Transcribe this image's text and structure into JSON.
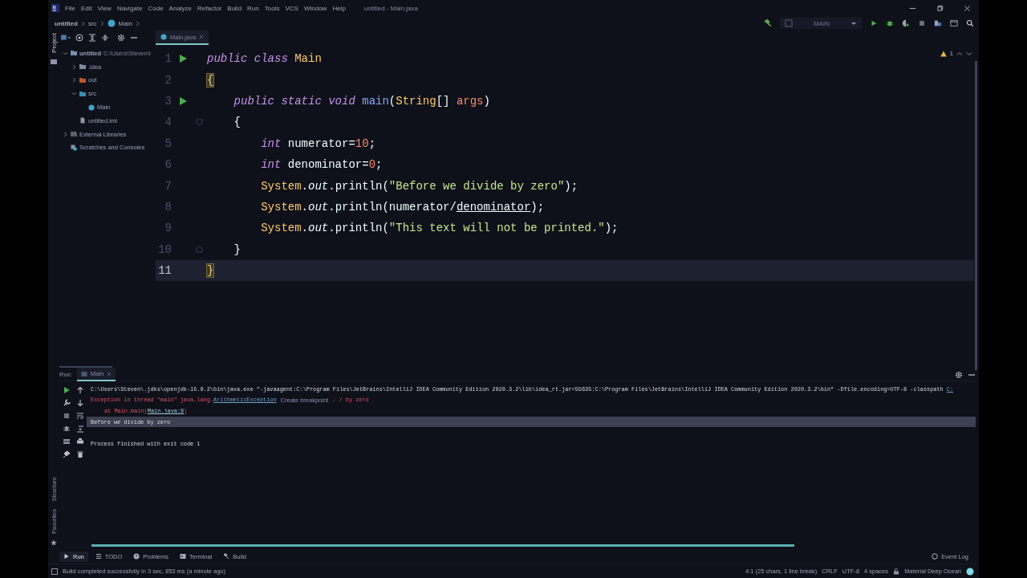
{
  "menu_bar": {
    "items": [
      "File",
      "Edit",
      "View",
      "Navigate",
      "Code",
      "Analyze",
      "Refactor",
      "Build",
      "Run",
      "Tools",
      "VCS",
      "Window",
      "Help"
    ],
    "title": "untitled - Main.java"
  },
  "breadcrumbs": [
    "untitled",
    "src",
    "Main"
  ],
  "toolbar": {
    "run_config": "MAIN"
  },
  "side_stripe": {
    "top": "Project",
    "bottom": [
      "Structure",
      "Favorites"
    ]
  },
  "project_tree": [
    {
      "label": "untitled",
      "path": "C:\\Users\\Steven\\I",
      "kind": "module",
      "expanded": true,
      "children": [
        {
          "label": ".idea",
          "kind": "folder",
          "expanded": false
        },
        {
          "label": "out",
          "kind": "excluded",
          "expanded": false
        },
        {
          "label": "src",
          "kind": "source",
          "expanded": true,
          "children": [
            {
              "label": "Main",
              "kind": "class"
            }
          ]
        },
        {
          "label": "untitled.iml",
          "kind": "file"
        }
      ]
    },
    {
      "label": "External Libraries",
      "kind": "library",
      "expanded": false
    },
    {
      "label": "Scratches and Consoles",
      "kind": "scratch"
    }
  ],
  "editor_tabs": [
    {
      "label": "Main.java",
      "selected": true
    }
  ],
  "inspection": {
    "warnings": "1"
  },
  "code": [
    {
      "number": "1",
      "current": false,
      "run_marker": true,
      "fold_marker": false,
      "tokens": [
        {
          "text": "public class ",
          "kind": "keyword"
        },
        {
          "text": "Main",
          "kind": "class"
        }
      ]
    },
    {
      "number": "2",
      "current": false,
      "run_marker": false,
      "fold_marker": false,
      "tokens": [
        {
          "text": "{",
          "kind": "brace-match"
        }
      ],
      "children": [
        {
          "number": "3",
          "current": false,
          "run_marker": true,
          "fold_marker": false,
          "tokens": [
            {
              "text": "public static void ",
              "kind": "keyword"
            },
            {
              "text": "main",
              "kind": "method"
            },
            {
              "text": "(",
              "kind": "plain"
            },
            {
              "text": "String",
              "kind": "class"
            },
            {
              "text": "[] ",
              "kind": "plain"
            },
            {
              "text": "args",
              "kind": "param"
            },
            {
              "text": ")",
              "kind": "plain"
            }
          ]
        },
        {
          "number": "4",
          "current": false,
          "run_marker": false,
          "fold_marker": true,
          "tokens": [
            {
              "text": "{",
              "kind": "plain"
            }
          ],
          "children": [
            {
              "number": "5",
              "current": false,
              "run_marker": false,
              "fold_marker": false,
              "tokens": [
                {
                  "text": "int ",
                  "kind": "keyword"
                },
                {
                  "text": "numerator=",
                  "kind": "plain"
                },
                {
                  "text": "10",
                  "kind": "number"
                },
                {
                  "text": ";",
                  "kind": "plain"
                }
              ]
            },
            {
              "number": "6",
              "current": false,
              "run_marker": false,
              "fold_marker": false,
              "tokens": [
                {
                  "text": "int ",
                  "kind": "keyword"
                },
                {
                  "text": "denominator=",
                  "kind": "plain"
                },
                {
                  "text": "0",
                  "kind": "number"
                },
                {
                  "text": ";",
                  "kind": "plain"
                }
              ]
            },
            {
              "number": "7",
              "current": false,
              "run_marker": false,
              "fold_marker": false,
              "tokens": [
                {
                  "text": "System",
                  "kind": "class"
                },
                {
                  "text": ".",
                  "kind": "plain"
                },
                {
                  "text": "out",
                  "kind": "field"
                },
                {
                  "text": ".println(",
                  "kind": "plain"
                },
                {
                  "text": "\"Before we divide by zero\"",
                  "kind": "string"
                },
                {
                  "text": ");",
                  "kind": "plain"
                }
              ]
            },
            {
              "number": "8",
              "current": false,
              "run_marker": false,
              "fold_marker": false,
              "tokens": [
                {
                  "text": "System",
                  "kind": "class"
                },
                {
                  "text": ".",
                  "kind": "plain"
                },
                {
                  "text": "out",
                  "kind": "field"
                },
                {
                  "text": ".println(numerator/",
                  "kind": "plain"
                },
                {
                  "text": "denominator",
                  "kind": "underlined"
                },
                {
                  "text": ");",
                  "kind": "plain"
                }
              ]
            },
            {
              "number": "9",
              "current": false,
              "run_marker": false,
              "fold_marker": false,
              "tokens": [
                {
                  "text": "System",
                  "kind": "class"
                },
                {
                  "text": ".",
                  "kind": "plain"
                },
                {
                  "text": "out",
                  "kind": "field"
                },
                {
                  "text": ".println(",
                  "kind": "plain"
                },
                {
                  "text": "\"This text will not be printed.\"",
                  "kind": "string"
                },
                {
                  "text": ");",
                  "kind": "plain"
                }
              ]
            }
          ]
        },
        {
          "number": "10",
          "current": false,
          "run_marker": false,
          "fold_marker": true,
          "tokens": [
            {
              "text": "}",
              "kind": "plain"
            }
          ]
        }
      ]
    },
    {
      "number": "11",
      "current": true,
      "run_marker": false,
      "fold_marker": false,
      "tokens": [
        {
          "text": "}",
          "kind": "brace-match"
        }
      ]
    }
  ],
  "run_panel": {
    "label": "Run:",
    "tabs": [
      {
        "label": "Main",
        "selected": true
      }
    ],
    "console": [
      {
        "kind": "command",
        "selected": false,
        "segments": [
          {
            "text": "C:\\Users\\Steven\\.jdks\\openjdk-15.0.2\\bin\\java.exe \"-javaagent:C:\\Program Files\\JetBrains\\IntelliJ IDEA Community Edition 2020.3.2\\lib\\idea_rt.jar=55635:C:\\Program Files\\JetBrains\\IntelliJ IDEA Community Edition 2020.3.2\\bin\" -Dfile.encoding=UTF-8 -classpath ",
            "kind": "plain"
          },
          {
            "text": "C:",
            "kind": "link"
          }
        ]
      },
      {
        "kind": "error",
        "selected": false,
        "segments": [
          {
            "text": "Exception in thread \"main\" java.lang.",
            "kind": "error"
          },
          {
            "text": "ArithmeticException",
            "kind": "link"
          },
          {
            "text": "Create breakpoint",
            "kind": "hint"
          },
          {
            "text": ": / by zero",
            "kind": "error"
          }
        ]
      },
      {
        "kind": "trace",
        "selected": false,
        "segments": [
          {
            "text": "at Main.main(",
            "kind": "error"
          },
          {
            "text": "Main.java:8",
            "kind": "link"
          },
          {
            "text": ")",
            "kind": "error"
          }
        ]
      },
      {
        "kind": "output",
        "selected": true,
        "segments": [
          {
            "text": "Before we divide by zero",
            "kind": "plain"
          }
        ]
      },
      {
        "kind": "process",
        "selected": false,
        "segments": [
          {
            "text": "Process finished with exit code 1",
            "kind": "plain"
          }
        ]
      }
    ]
  },
  "tool_windows": [
    {
      "label": "Run",
      "kind": "run",
      "selected": true
    },
    {
      "label": "TODO",
      "kind": "todo",
      "selected": false
    },
    {
      "label": "Problems",
      "kind": "problems",
      "selected": false
    },
    {
      "label": "Terminal",
      "kind": "terminal",
      "selected": false
    },
    {
      "label": "Build",
      "kind": "build",
      "selected": false
    }
  ],
  "event_log": "Event Log",
  "status_bar": {
    "message": "Build completed successfully in 3 sec, 853 ms (a minute ago)",
    "items": [
      "4:1 (25 chars, 1 line break)",
      "CRLF",
      "UTF-8",
      "4 spaces"
    ],
    "theme": "Material Deep Ocean"
  }
}
